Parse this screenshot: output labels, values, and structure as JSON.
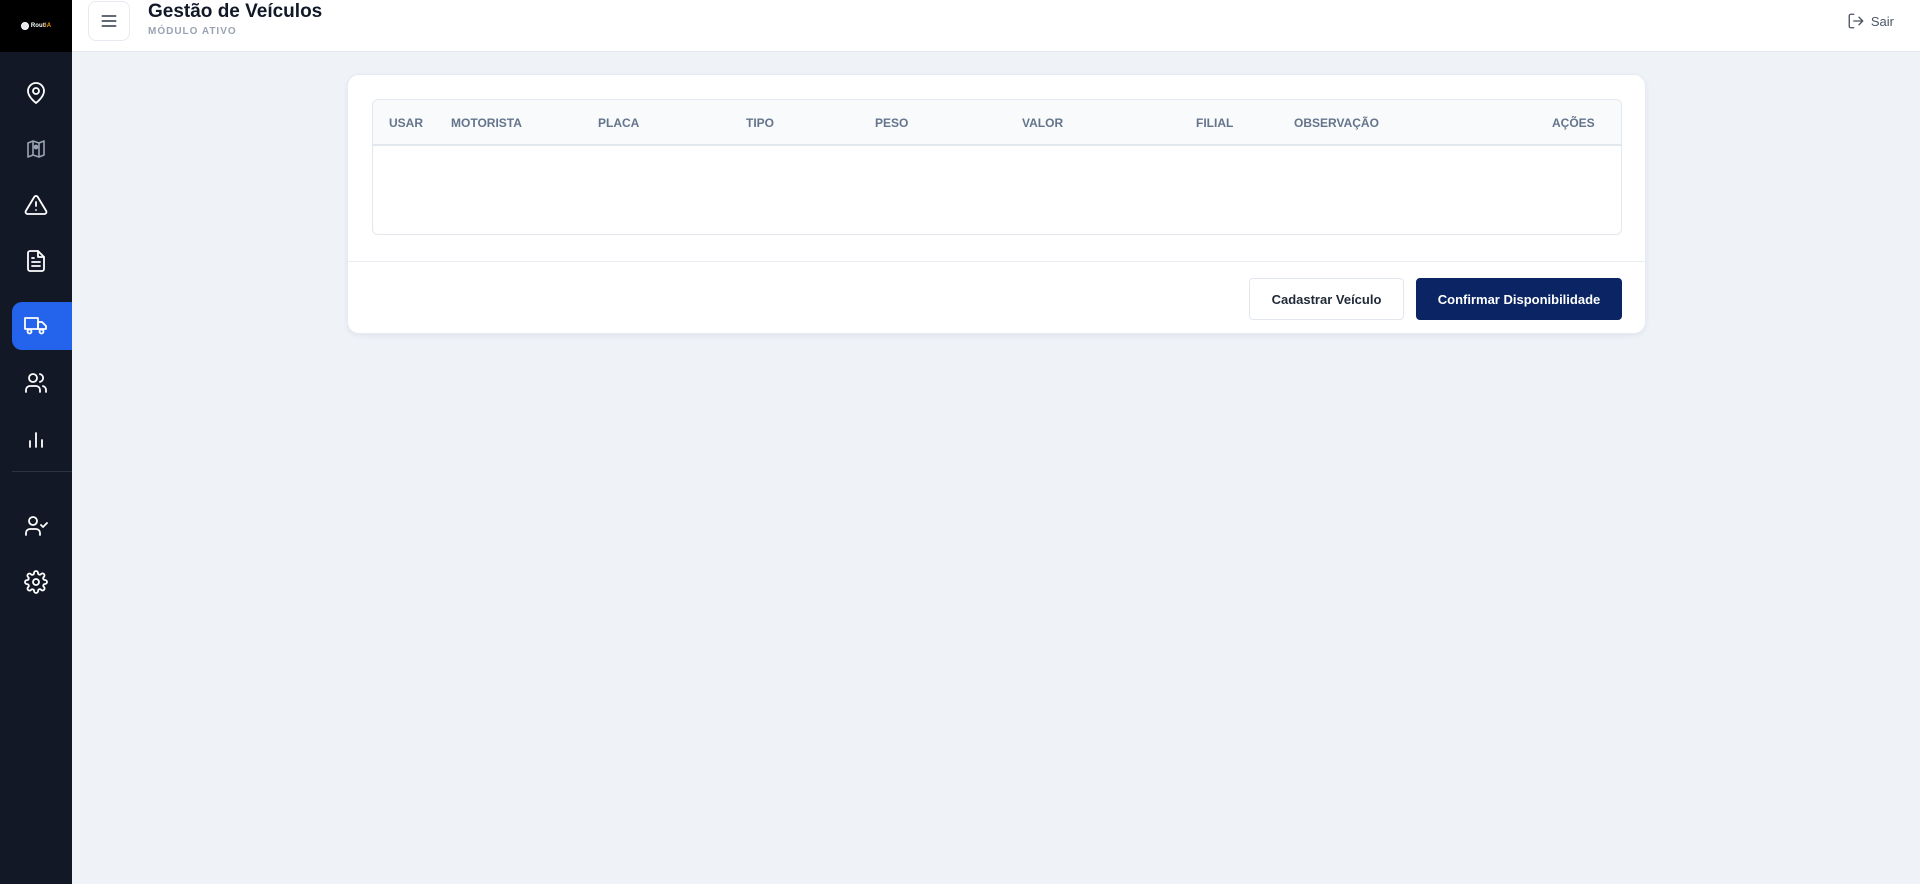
{
  "brand": {
    "logo_text": "RouteIA",
    "logo_text_main": "Rout",
    "logo_text_accent": "IA"
  },
  "sidebar": {
    "items": [
      {
        "name": "location",
        "icon": "map-pin-icon"
      },
      {
        "name": "map",
        "icon": "map-icon"
      },
      {
        "name": "alerts",
        "icon": "alert-triangle-icon"
      },
      {
        "name": "documents",
        "icon": "file-text-icon"
      },
      {
        "name": "vehicles",
        "icon": "truck-icon",
        "active": true
      },
      {
        "name": "users",
        "icon": "users-icon"
      },
      {
        "name": "reports",
        "icon": "bar-chart-icon"
      },
      {
        "name": "user-approval",
        "icon": "user-check-icon"
      },
      {
        "name": "settings",
        "icon": "gear-icon"
      }
    ],
    "active_color": "#2463eb",
    "background": "#121826"
  },
  "header": {
    "title": "Gestão de Veículos",
    "subtitle": "MÓDULO ATIVO",
    "logout_label": "Sair"
  },
  "table": {
    "columns": [
      "USAR",
      "MOTORISTA",
      "PLACA",
      "TIPO",
      "PESO",
      "VALOR",
      "FILIAL",
      "OBSERVAÇÃO",
      "AÇÕES"
    ],
    "rows": []
  },
  "actions": {
    "register_label": "Cadastrar Veículo",
    "confirm_label": "Confirmar Disponibilidade",
    "primary_color": "#0b2463"
  }
}
